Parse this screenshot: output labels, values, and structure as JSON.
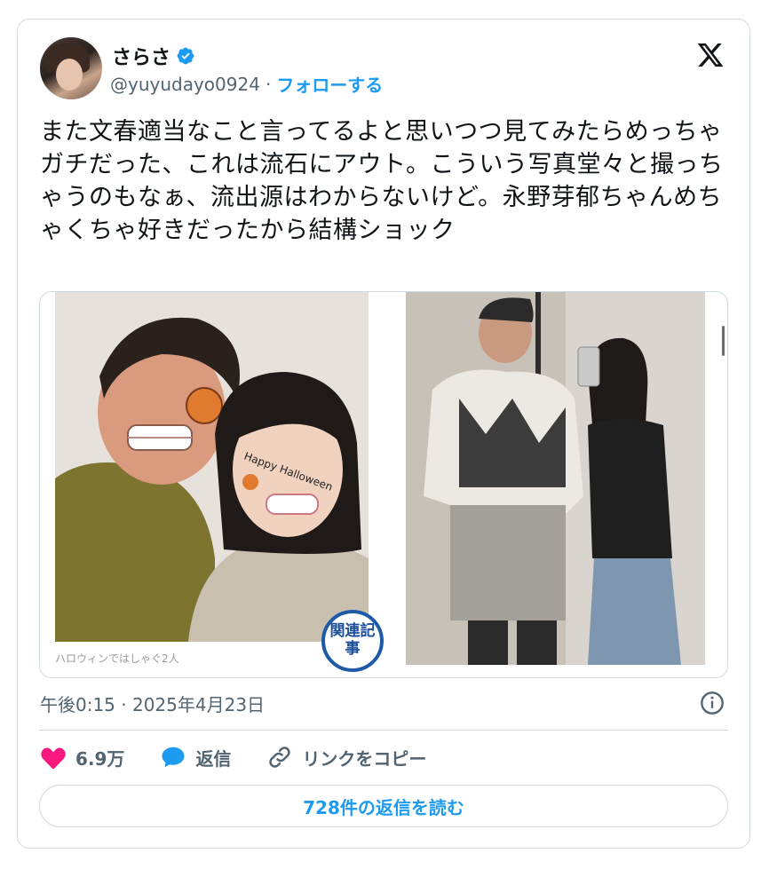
{
  "author": {
    "display_name": "さらさ",
    "handle": "@yuyudayo0924",
    "separator": "·",
    "follow_label": "フォローする"
  },
  "tweet": {
    "text": "また文春適当なこと言ってるよと思いつつ見てみたらめっちゃガチだった、これは流石にアウト。こういう写真堂々と撮っちゃうのもなぁ、流出源はわからないけど。永野芽郁ちゃんめちゃくちゃ好きだったから結構ショック"
  },
  "media": {
    "left_caption": "ハロウィンではしゃぐ2人",
    "badge_label": "関連記事",
    "left_sticker_text": "Happy Halloween"
  },
  "meta": {
    "timestamp": "午後0:15 · 2025年4月23日"
  },
  "actions": {
    "like_count": "6.9万",
    "reply_label": "返信",
    "copy_link_label": "リンクをコピー"
  },
  "read_replies_label": "728件の返信を読む",
  "colors": {
    "accent": "#1d9bf0",
    "like": "#f91880",
    "text_secondary": "#536471",
    "border": "#cfd9de"
  },
  "icons": [
    "verified-badge-icon",
    "x-logo-icon",
    "info-icon",
    "heart-icon",
    "reply-bubble-icon",
    "link-icon"
  ]
}
